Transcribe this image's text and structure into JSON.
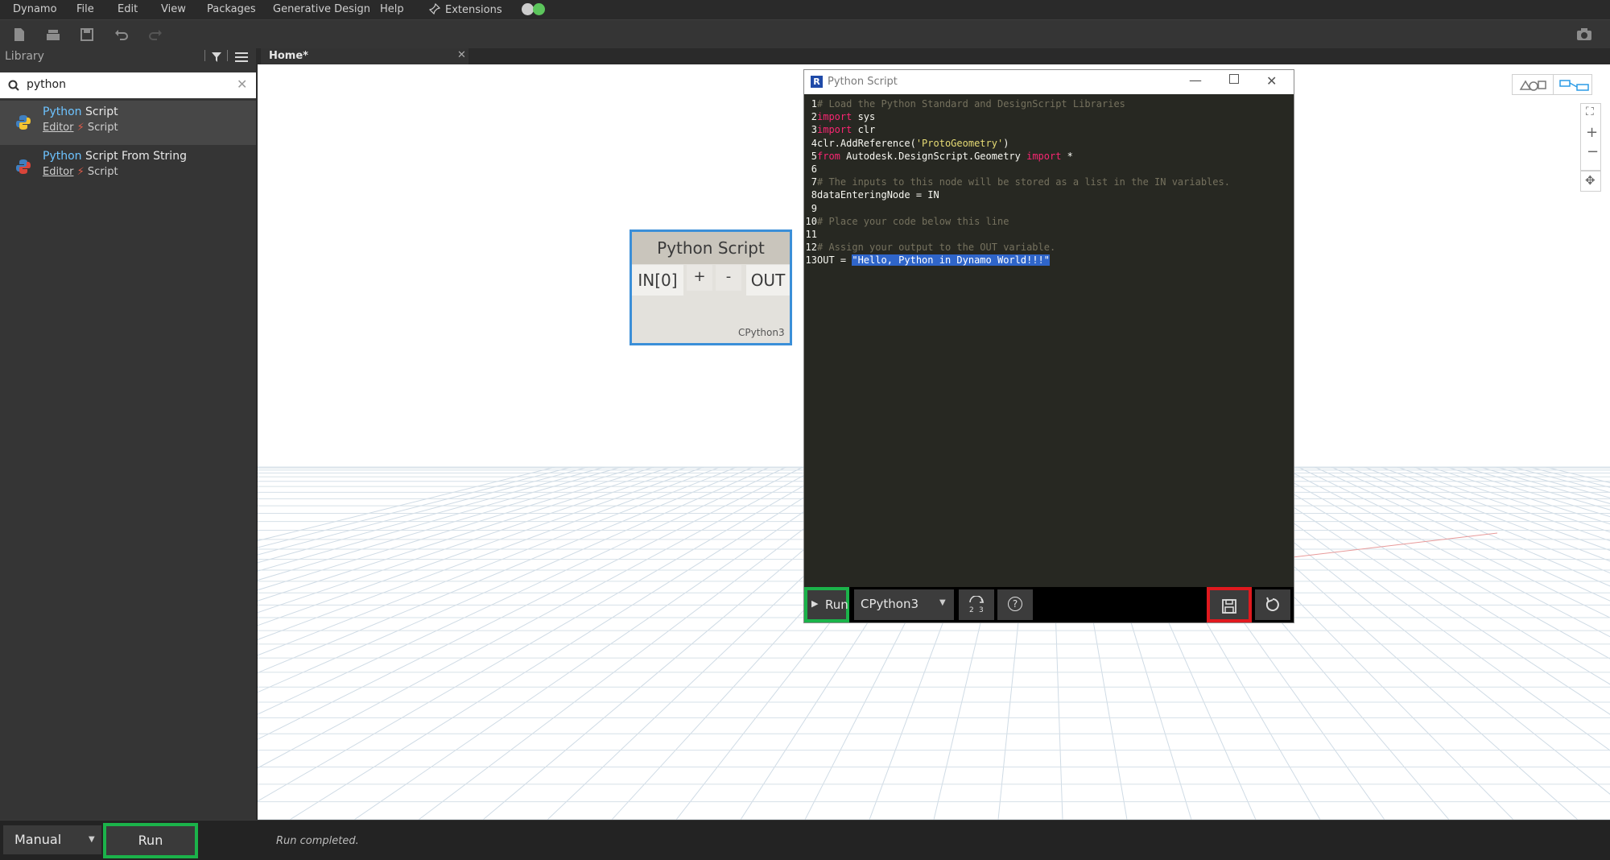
{
  "menu": {
    "items": [
      "Dynamo",
      "File",
      "Edit",
      "View",
      "Packages",
      "Generative Design",
      "Help"
    ],
    "extensions": "Extensions",
    "status_colors": [
      "#cccccc",
      "#5cc55c"
    ]
  },
  "toolbar": {
    "icons": [
      "new-file-icon",
      "open-file-icon",
      "save-icon",
      "undo-icon",
      "redo-icon",
      "camera-icon"
    ]
  },
  "library": {
    "title": "Library",
    "search": {
      "value": "python",
      "placeholder": ""
    },
    "results": [
      {
        "highlight": "Python",
        "rest": " Script",
        "category": "Editor",
        "type": "Script"
      },
      {
        "highlight": "Python",
        "rest": " Script From String",
        "category": "Editor",
        "type": "Script"
      }
    ]
  },
  "tab": {
    "label": "Home*"
  },
  "node": {
    "title": "Python Script",
    "input_port": "IN[0]",
    "add": "+",
    "remove": "-",
    "output_port": "OUT",
    "engine": "CPython3"
  },
  "editor": {
    "title": "Python Script",
    "lines": [
      {
        "n": "1",
        "parts": [
          {
            "t": "# Load the Python Standard and DesignScript Libraries",
            "c": "comment"
          }
        ]
      },
      {
        "n": "2",
        "parts": [
          {
            "t": "import",
            "c": "kw"
          },
          {
            "t": " sys",
            "c": ""
          }
        ]
      },
      {
        "n": "3",
        "parts": [
          {
            "t": "import",
            "c": "kw"
          },
          {
            "t": " clr",
            "c": ""
          }
        ]
      },
      {
        "n": "4",
        "parts": [
          {
            "t": "clr.AddReference(",
            "c": ""
          },
          {
            "t": "'ProtoGeometry'",
            "c": "str"
          },
          {
            "t": ")",
            "c": ""
          }
        ]
      },
      {
        "n": "5",
        "parts": [
          {
            "t": "from",
            "c": "kw"
          },
          {
            "t": " Autodesk.DesignScript.Geometry ",
            "c": ""
          },
          {
            "t": "import",
            "c": "kw"
          },
          {
            "t": " *",
            "c": ""
          }
        ]
      },
      {
        "n": "6",
        "parts": []
      },
      {
        "n": "7",
        "parts": [
          {
            "t": "# The inputs to this node will be stored as a list in the IN variables.",
            "c": "comment"
          }
        ]
      },
      {
        "n": "8",
        "parts": [
          {
            "t": "dataEnteringNode = IN",
            "c": ""
          }
        ]
      },
      {
        "n": "9",
        "parts": []
      },
      {
        "n": "10",
        "parts": [
          {
            "t": "# Place your code below this line",
            "c": "comment"
          }
        ]
      },
      {
        "n": "11",
        "parts": []
      },
      {
        "n": "12",
        "parts": [
          {
            "t": "# Assign your output to the OUT variable.",
            "c": "comment"
          }
        ]
      },
      {
        "n": "13",
        "parts": [
          {
            "t": "OUT = ",
            "c": ""
          },
          {
            "t": "\"Hello, Python in Dynamo World!!!\"",
            "c": "sel"
          }
        ]
      }
    ],
    "footer": {
      "run": "Run",
      "engine": "CPython3"
    }
  },
  "bottom": {
    "run_mode": "Manual",
    "run": "Run",
    "status": "Run completed."
  },
  "colors": {
    "highlight_green": "#1bb34a",
    "highlight_red": "#e0191e",
    "node_border": "#3b8fd8",
    "search_highlight": "#6dc3ff"
  }
}
